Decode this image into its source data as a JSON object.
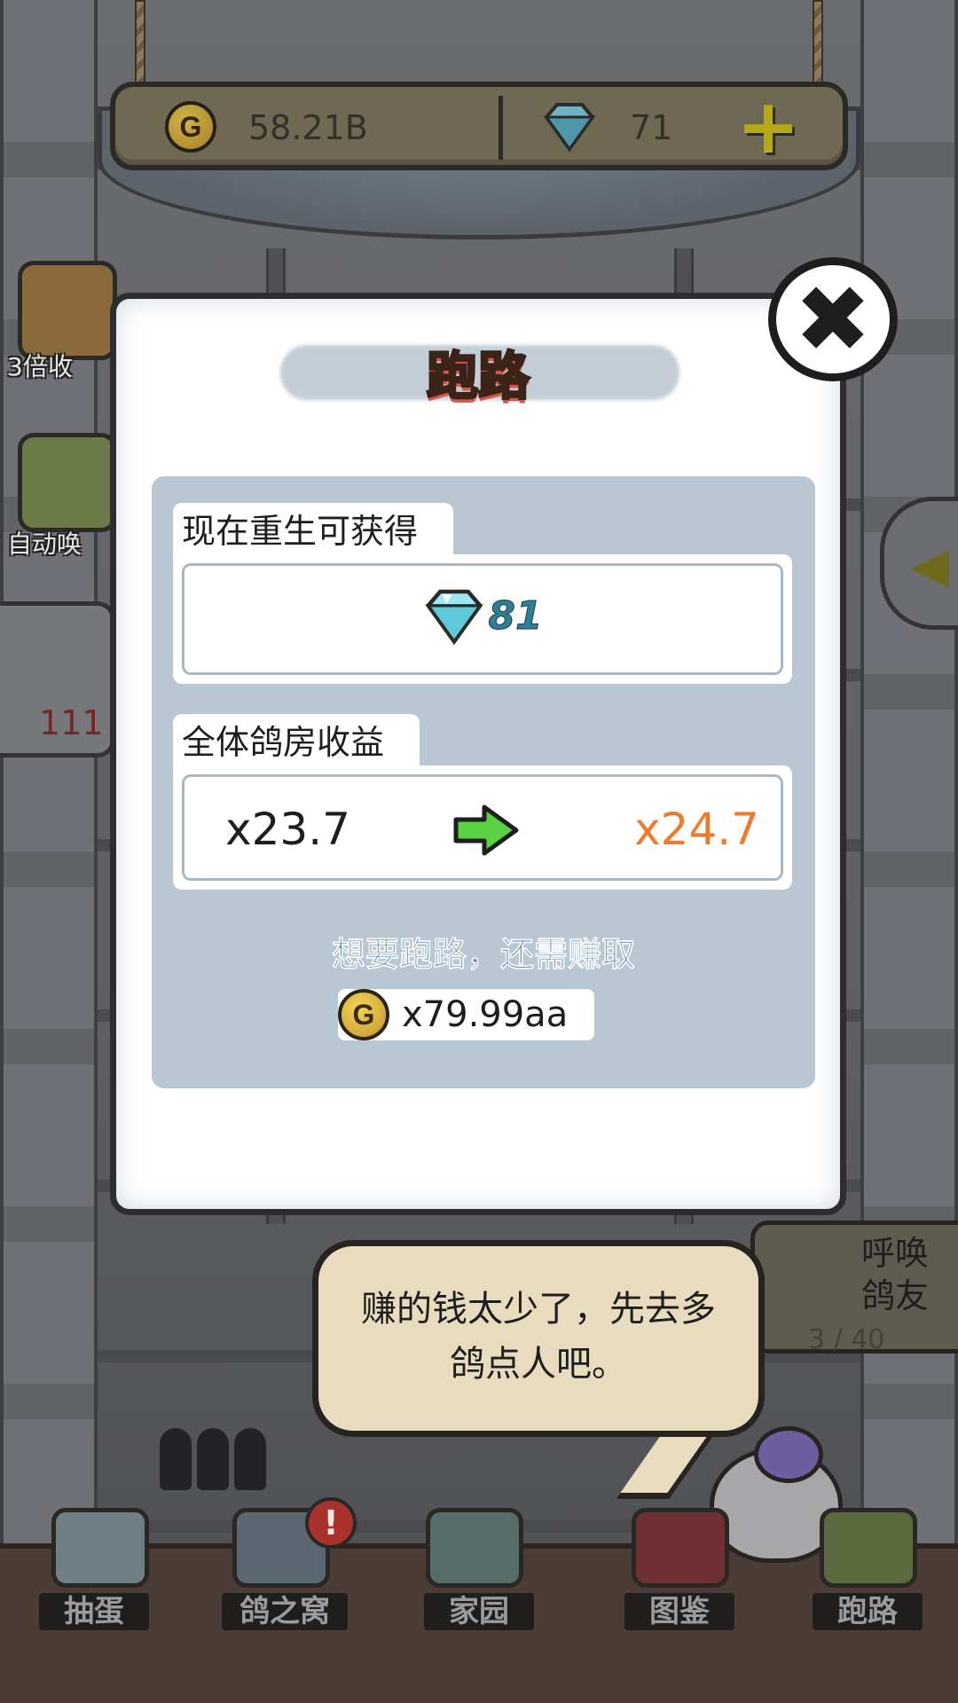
{
  "currency": {
    "gold": "58.21B",
    "gems": "71",
    "add_label": "+",
    "coin_letter": "G"
  },
  "side_buttons": {
    "triple_income": "3倍收",
    "auto_summon": "自动唤",
    "panel_count": "111"
  },
  "dialog": {
    "title": "跑路",
    "close_label": "✖",
    "reward_section": {
      "label": "现在重生可获得",
      "gems": "81"
    },
    "income_section": {
      "label": "全体鸽房收益",
      "current": "x23.7",
      "next": "x24.7"
    },
    "requirement": {
      "text": "想要跑路，还需赚取",
      "amount": "x79.99aa"
    }
  },
  "bubble": {
    "line1": "赚的钱太少了，先去多",
    "line2": "鸽点人吧。"
  },
  "summon": {
    "label": "呼唤鸽友",
    "count": "3 / 40"
  },
  "nav": {
    "items": [
      {
        "label": "抽蛋"
      },
      {
        "label": "鸽之窝"
      },
      {
        "label": "家园"
      },
      {
        "label": "图鉴"
      },
      {
        "label": "跑路"
      }
    ],
    "alert": "!"
  },
  "colors": {
    "title_fill": "#f6c64a",
    "gem_value": "#2f7e93",
    "new_multiplier": "#ec7b2b",
    "requirement_text": "#5f8fb1"
  }
}
